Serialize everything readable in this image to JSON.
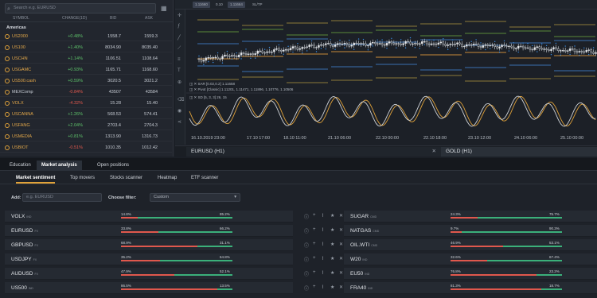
{
  "watchlist": {
    "search_placeholder": "Search e.g. EURUSD",
    "columns": [
      "SYMBOL",
      "CHANGE(1D)",
      "BID",
      "ASK"
    ],
    "group": "Americas",
    "rows": [
      {
        "symbol": "US2000",
        "tag": "IND",
        "change": "+0.48%",
        "bid": "1558.7",
        "ask": "1559.3",
        "dir": "pos",
        "fav": true
      },
      {
        "symbol": "US100",
        "tag": "IND",
        "change": "+1.40%",
        "bid": "8034.90",
        "ask": "8035.40",
        "dir": "pos",
        "fav": true
      },
      {
        "symbol": "USCHN",
        "tag": "IND",
        "change": "+1.14%",
        "bid": "1106.51",
        "ask": "1108.64",
        "dir": "pos",
        "fav": true
      },
      {
        "symbol": "USGAMC",
        "tag": "IND",
        "change": "+0.93%",
        "bid": "1165.71",
        "ask": "1168.60",
        "dir": "pos",
        "fav": true
      },
      {
        "symbol": "US500.cash",
        "tag": "IND",
        "change": "+0.59%",
        "bid": "3020.5",
        "ask": "3021.2",
        "dir": "pos",
        "fav": true
      },
      {
        "symbol": "MEXComp",
        "tag": "IND",
        "change": "-0.84%",
        "bid": "43507",
        "ask": "43584",
        "dir": "neg",
        "fav": false
      },
      {
        "symbol": "VOLX",
        "tag": "IND",
        "change": "-4.32%",
        "bid": "15.28",
        "ask": "15.40",
        "dir": "neg",
        "fav": true
      },
      {
        "symbol": "USCANNA",
        "tag": "IND",
        "change": "+1.26%",
        "bid": "568.53",
        "ask": "574.41",
        "dir": "pos",
        "fav": true
      },
      {
        "symbol": "USFANG",
        "tag": "IND",
        "change": "+2.04%",
        "bid": "2703.4",
        "ask": "2704.3",
        "dir": "pos",
        "fav": true
      },
      {
        "symbol": "USMEDIA",
        "tag": "IND",
        "change": "+0.81%",
        "bid": "1313.90",
        "ask": "1316.73",
        "dir": "pos",
        "fav": true
      },
      {
        "symbol": "USBIOT",
        "tag": "IND",
        "change": "-0.51%",
        "bid": "1010.35",
        "ask": "1012.42",
        "dir": "neg",
        "fav": true
      }
    ]
  },
  "chart": {
    "toolbar": [
      "1.11660",
      "0.10",
      "1.11664",
      "SL/TP"
    ],
    "indicator_sar": "SAR [0.02,0.2] 1.11658",
    "indicator_pivot": "Pivot [Classic] 1.11201, 1.11471, 1.11896, 1.10776, 1.10506",
    "indicator_sd": "SD [5, 3, 3] 26, 15",
    "dates": [
      "16.10.2019 23:00",
      "17.10 17:00",
      "18.10 11:00",
      "21.10 06:00",
      "22.10 00:00",
      "22.10 18:00",
      "23.10 12:00",
      "24.10 06:00",
      "25.10 00:00"
    ],
    "tab_main": "EURUSD (H1)",
    "tab_second": "GOLD (H1)"
  },
  "bottom": {
    "tabs": [
      "Education",
      "Market analysis",
      "Open positions"
    ],
    "subtabs": [
      "Market sentiment",
      "Top movers",
      "Stocks scanner",
      "Heatmap",
      "ETF scanner"
    ],
    "add_label": "Add:",
    "add_placeholder": "e.g. EURUSD",
    "filter_label": "Choose filter:",
    "filter_value": "Custom",
    "left_rows": [
      {
        "name": "VOLX",
        "tag": "IND",
        "sell": 14.8,
        "buy": 85.2,
        "sell_text": "14.8%",
        "buy_text": "85.2%"
      },
      {
        "name": "EURUSD",
        "tag": "FX",
        "sell": 33.8,
        "buy": 66.2,
        "sell_text": "33.8%",
        "buy_text": "66.2%"
      },
      {
        "name": "GBPUSD",
        "tag": "FX",
        "sell": 68.9,
        "buy": 31.1,
        "sell_text": "68.9%",
        "buy_text": "31.1%"
      },
      {
        "name": "USDJPY",
        "tag": "FX",
        "sell": 35.2,
        "buy": 64.8,
        "sell_text": "35.2%",
        "buy_text": "64.8%"
      },
      {
        "name": "AUDUSD",
        "tag": "FX",
        "sell": 47.9,
        "buy": 52.1,
        "sell_text": "47.9%",
        "buy_text": "52.1%"
      },
      {
        "name": "US500",
        "tag": "IND",
        "sell": 86.5,
        "buy": 13.5,
        "sell_text": "86.5%",
        "buy_text": "13.5%"
      }
    ],
    "right_rows": [
      {
        "name": "SUGAR",
        "tag": "CMD",
        "sell": 24.3,
        "buy": 75.7,
        "sell_text": "24.3%",
        "buy_text": "75.7%"
      },
      {
        "name": "NATGAS",
        "tag": "CMD",
        "sell": 9.7,
        "buy": 90.3,
        "sell_text": "9.7%",
        "buy_text": "90.3%"
      },
      {
        "name": "OIL.WTI",
        "tag": "CMD",
        "sell": 46.9,
        "buy": 53.1,
        "sell_text": "46.9%",
        "buy_text": "53.1%"
      },
      {
        "name": "W20",
        "tag": "IND",
        "sell": 32.6,
        "buy": 67.4,
        "sell_text": "32.6%",
        "buy_text": "67.4%"
      },
      {
        "name": "EU50",
        "tag": "IND",
        "sell": 76.8,
        "buy": 23.2,
        "sell_text": "76.8%",
        "buy_text": "23.2%"
      },
      {
        "name": "FRA40",
        "tag": "IND",
        "sell": 81.3,
        "buy": 18.7,
        "sell_text": "81.3%",
        "buy_text": "18.7%"
      }
    ]
  },
  "colors": {
    "accent": "#e0a23a",
    "positive": "#3bb07a",
    "negative": "#e0584d"
  }
}
